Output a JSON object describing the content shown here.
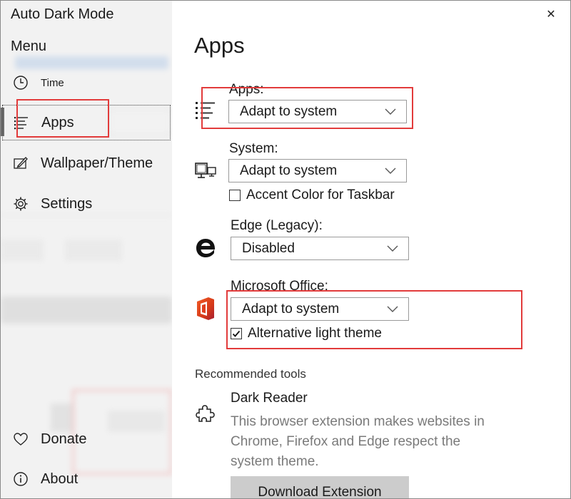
{
  "window": {
    "title": "Auto Dark Mode",
    "close_glyph": "✕"
  },
  "sidebar": {
    "menu_title": "Menu",
    "items": [
      {
        "id": "time",
        "label": "Time",
        "icon": "clock-icon"
      },
      {
        "id": "apps",
        "label": "Apps",
        "icon": "list-icon",
        "selected": true
      },
      {
        "id": "wallpaper",
        "label": "Wallpaper/Theme",
        "icon": "brush-icon"
      },
      {
        "id": "settings",
        "label": "Settings",
        "icon": "gear-icon"
      }
    ],
    "footer_items": [
      {
        "id": "donate",
        "label": "Donate",
        "icon": "heart-icon"
      },
      {
        "id": "about",
        "label": "About",
        "icon": "info-icon"
      }
    ]
  },
  "main": {
    "title": "Apps",
    "sections": {
      "apps": {
        "label": "Apps:",
        "selected": "Adapt to system",
        "icon": "list-icon"
      },
      "system": {
        "label": "System:",
        "selected": "Adapt to system",
        "icon": "monitor-icon",
        "checkbox": {
          "label": "Accent Color for Taskbar",
          "checked": false
        }
      },
      "edge": {
        "label": "Edge (Legacy):",
        "selected": "Disabled",
        "icon": "edge-icon"
      },
      "office": {
        "label": "Microsoft Office:",
        "selected": "Adapt to system",
        "icon": "office-icon",
        "checkbox": {
          "label": "Alternative light theme",
          "checked": true
        }
      }
    },
    "recommended": {
      "title": "Recommended tools",
      "tool_name": "Dark Reader",
      "tool_icon": "puzzle-icon",
      "tool_description": "This browser extension makes websites in Chrome, Firefox and Edge respect the system theme.",
      "button_label": "Download Extension"
    }
  },
  "colors": {
    "highlight_box": "#e23b3b",
    "sidebar_bg": "#f2f2f2",
    "description_text": "#7a7a7a",
    "button_bg": "#cccccc"
  }
}
